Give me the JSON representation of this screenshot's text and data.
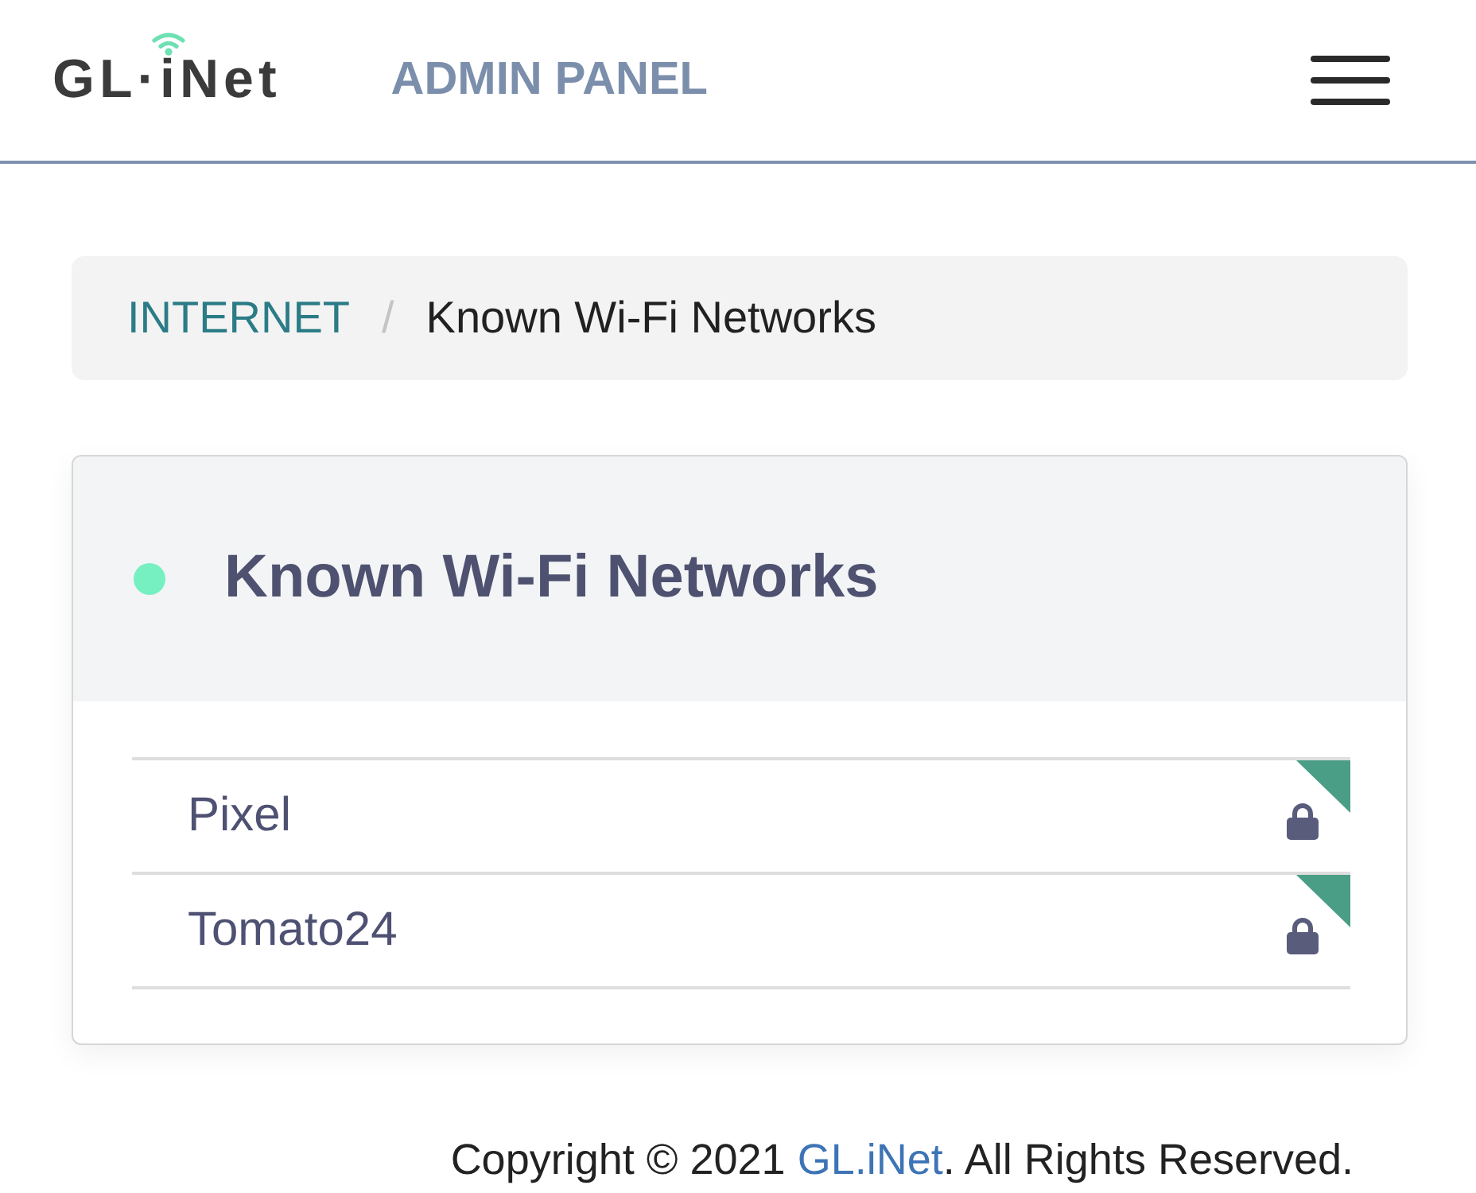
{
  "header": {
    "logo": "GL·iNet",
    "title": "ADMIN PANEL"
  },
  "breadcrumb": {
    "separator": "/",
    "items": [
      {
        "label": "INTERNET",
        "active": false
      },
      {
        "label": "Known Wi-Fi Networks",
        "active": true
      }
    ]
  },
  "card": {
    "title": "Known Wi-Fi Networks",
    "networks": [
      {
        "name": "Pixel",
        "secured": true
      },
      {
        "name": "Tomato24",
        "secured": true
      }
    ]
  },
  "footer": {
    "prefix": "Copyright © 2021 ",
    "link": "GL.iNet",
    "suffix": ". All Rights Reserved."
  }
}
